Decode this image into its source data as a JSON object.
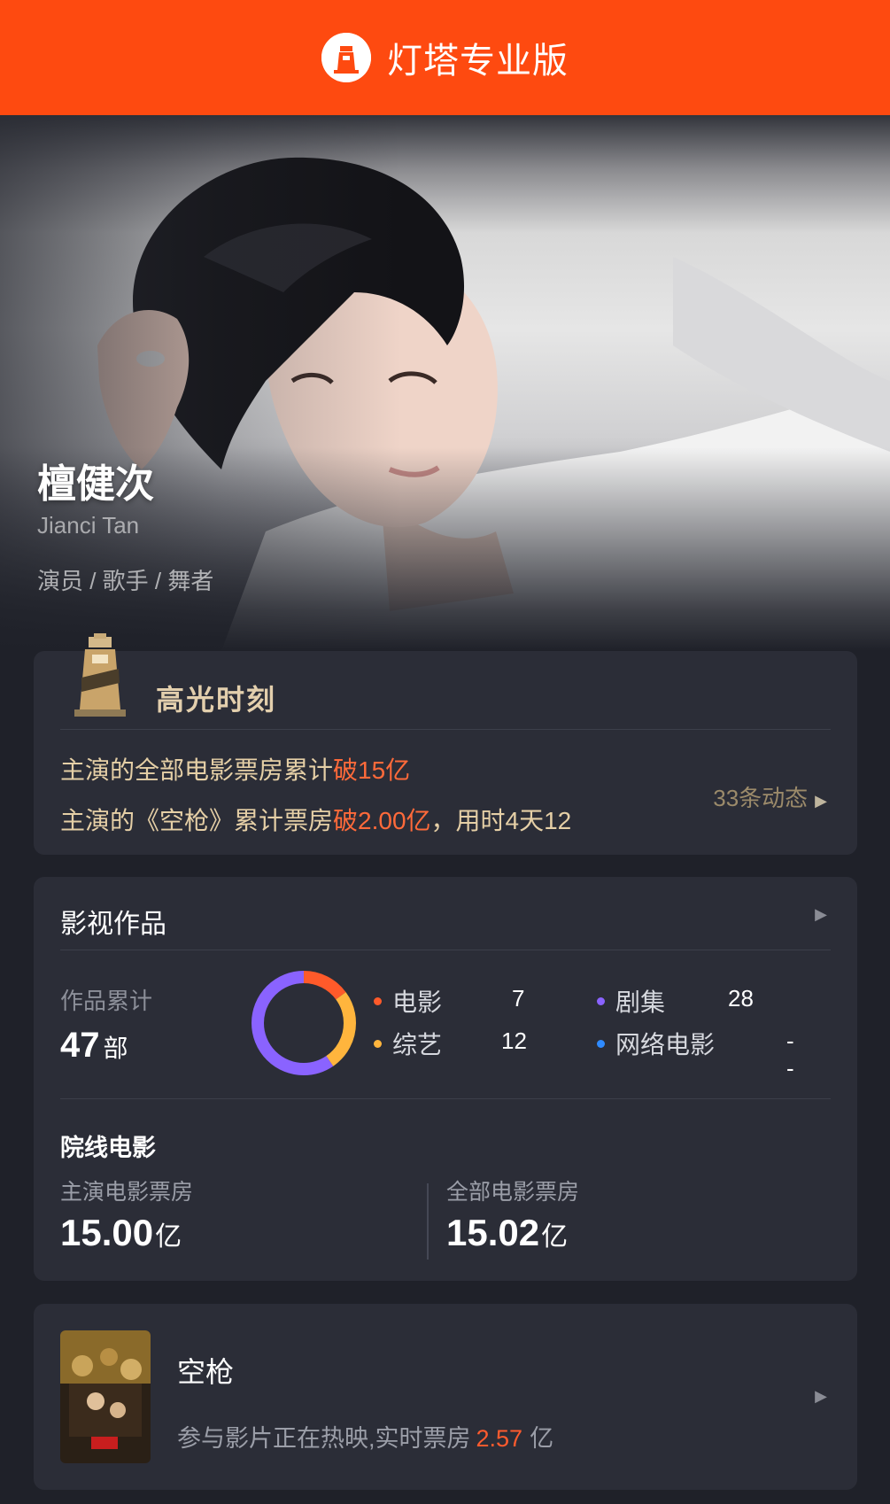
{
  "header": {
    "app_title": "灯塔专业版",
    "logo_icon": "lighthouse-logo-icon"
  },
  "profile": {
    "name_cn": "檀健次",
    "name_en": "Jianci Tan",
    "roles": "演员 / 歌手 / 舞者"
  },
  "highlight": {
    "title": "高光时刻",
    "line1_prefix": "主演的全部电影票房累计",
    "line1_hot": "破15亿",
    "line2_prefix": "主演的《空枪》累计票房",
    "line2_hot": "破2.00亿",
    "line2_suffix": "，用时4天12",
    "more_label": "33条动态",
    "accent_color": "#ff6a3a"
  },
  "works": {
    "title": "影视作品",
    "total_label": "作品累计",
    "total_value": "47",
    "total_unit": "部",
    "categories": [
      {
        "label": "电影",
        "value": "7",
        "color": "#ff5a2a"
      },
      {
        "label": "剧集",
        "value": "28",
        "color": "#8a63ff"
      },
      {
        "label": "综艺",
        "value": "12",
        "color": "#ffb53d"
      },
      {
        "label": "网络电影",
        "value": "--",
        "color": "#2f8bff"
      }
    ],
    "section_title": "院线电影",
    "lead_box_label": "主演电影票房",
    "lead_box_value": "15.00",
    "all_box_label": "全部电影票房",
    "all_box_value": "15.02",
    "unit": "亿"
  },
  "film": {
    "title": "空枪",
    "status_prefix": "参与影片正在热映,实时票房",
    "realtime_value": "2.57",
    "realtime_unit": "亿"
  }
}
